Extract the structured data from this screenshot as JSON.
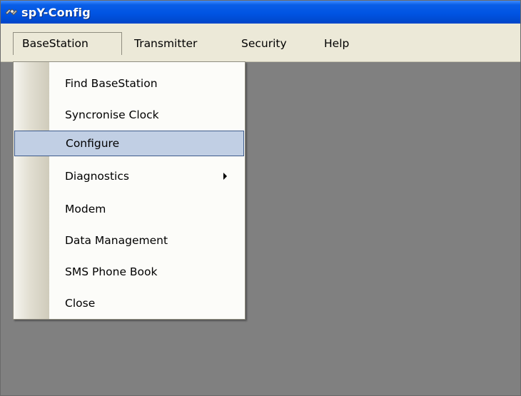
{
  "window": {
    "title": "spY-Config",
    "icon": "spy-satellite-icon"
  },
  "menubar": {
    "items": [
      {
        "label": "BaseStation"
      },
      {
        "label": "Transmitter"
      },
      {
        "label": "Security"
      },
      {
        "label": "Help"
      }
    ]
  },
  "dropdown": {
    "items": [
      {
        "label": "Find BaseStation"
      },
      {
        "label": "Syncronise Clock"
      },
      {
        "label": "Configure",
        "highlighted": true
      },
      {
        "label": "Diagnostics",
        "submenu": true,
        "submenu_icon": "chevron-right-icon"
      },
      {
        "label": "Modem"
      },
      {
        "label": "Data Management"
      },
      {
        "label": "SMS Phone Book"
      },
      {
        "label": "Close"
      }
    ]
  },
  "colors": {
    "titlebar": "#0054e3",
    "menubar": "#ece9d8",
    "workspace": "#808080",
    "highlight": "#c1cfe4",
    "highlight_border": "#3d5a8a"
  }
}
